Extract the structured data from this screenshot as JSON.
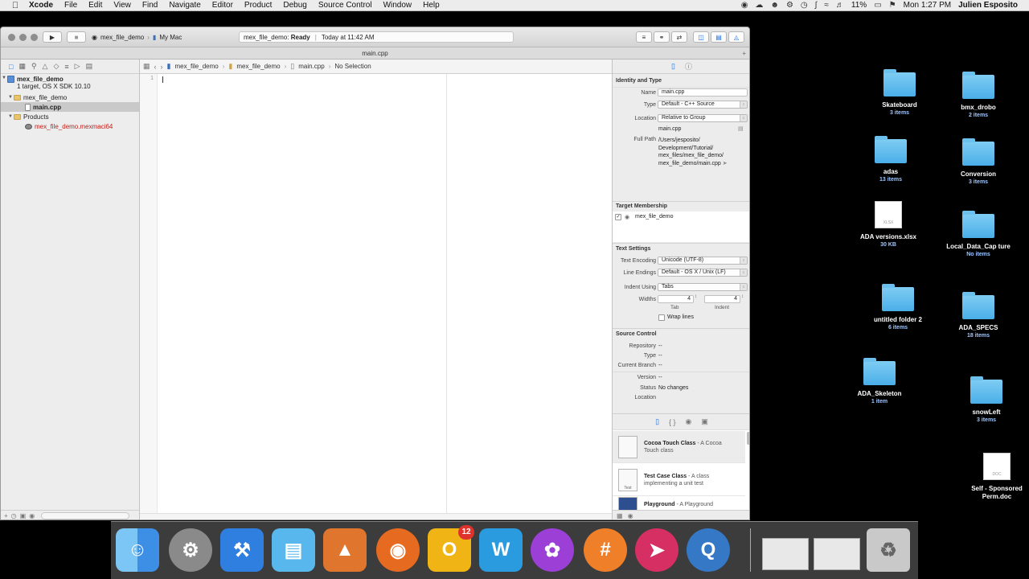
{
  "menubar": {
    "app": "Xcode",
    "menus": [
      "File",
      "Edit",
      "View",
      "Find",
      "Navigate",
      "Editor",
      "Product",
      "Debug",
      "Source Control",
      "Window",
      "Help"
    ],
    "battery": "11%",
    "clock": "Mon 1:27 PM",
    "user": "Julien Esposito"
  },
  "toolbar": {
    "scheme": "mex_file_demo",
    "destination": "My Mac",
    "activity_project": "mex_file_demo:",
    "activity_status": "Ready",
    "activity_time": "Today at 11:42 AM"
  },
  "tab": {
    "title": "main.cpp"
  },
  "navigator": {
    "project_name": "mex_file_demo",
    "project_sub": "1 target, OS X SDK 10.10",
    "group": "mex_file_demo",
    "file": "main.cpp",
    "products_group": "Products",
    "product": "mex_file_demo.mexmaci64"
  },
  "jumpbar": {
    "crumbs": [
      "mex_file_demo",
      "mex_file_demo",
      "main.cpp",
      "No Selection"
    ]
  },
  "editor": {
    "line_number": "1"
  },
  "inspector": {
    "identity": {
      "heading": "Identity and Type",
      "name_label": "Name",
      "name_value": "main.cpp",
      "type_label": "Type",
      "type_value": "Default - C++ Source",
      "location_label": "Location",
      "location_value": "Relative to Group",
      "location_file": "main.cpp",
      "fullpath_label": "Full Path",
      "fullpath_lines": [
        "/Users/jesposito/",
        "Development/Tutorial/",
        "mex_files/mex_file_demo/",
        "mex_file_demo/main.cpp"
      ]
    },
    "target": {
      "heading": "Target Membership",
      "item": "mex_file_demo"
    },
    "text": {
      "heading": "Text Settings",
      "encoding_label": "Text Encoding",
      "encoding_value": "Unicode (UTF-8)",
      "endings_label": "Line Endings",
      "endings_value": "Default - OS X / Unix (LF)",
      "indent_label": "Indent Using",
      "indent_value": "Tabs",
      "widths_label": "Widths",
      "tab_value": "4",
      "indent_width_value": "4",
      "tab_caption": "Tab",
      "indent_caption": "Indent",
      "wrap_label": "Wrap lines"
    },
    "source_control": {
      "heading": "Source Control",
      "repo_label": "Repository",
      "repo_value": "--",
      "type_label": "Type",
      "type_value": "--",
      "branch_label": "Current Branch",
      "branch_value": "--",
      "version_label": "Version",
      "version_value": "--",
      "status_label": "Status",
      "status_value": "No changes",
      "location_label": "Location"
    },
    "library": [
      {
        "title": "Cocoa Touch Class",
        "desc1": " - A Cocoa",
        "desc2": "Touch class"
      },
      {
        "title": "Test Case Class",
        "desc1": " - A class",
        "desc2": "implementing a unit test",
        "icon_text": "Test"
      },
      {
        "title": "Playground",
        "desc1": " - A Playground",
        "desc2": ""
      }
    ]
  },
  "desktop": [
    {
      "name": "Skateboard",
      "sub": "3 items",
      "kind": "folder"
    },
    {
      "name": "bmx_drobo",
      "sub": "2 items",
      "kind": "folder"
    },
    {
      "name": "adas",
      "sub": "13 items",
      "kind": "folder"
    },
    {
      "name": "Conversion",
      "sub": "3 items",
      "kind": "folder"
    },
    {
      "name": "ADA versions.xlsx",
      "sub": "30 KB",
      "kind": "file",
      "icon_text": "XLSX"
    },
    {
      "name": "Local_Data_Cap ture",
      "sub": "No items",
      "kind": "folder"
    },
    {
      "name": "untitled folder 2",
      "sub": "6 items",
      "kind": "folder"
    },
    {
      "name": "ADA_SPECS",
      "sub": "18 items",
      "kind": "folder"
    },
    {
      "name": "ADA_Skeleton",
      "sub": "1 item",
      "kind": "folder"
    },
    {
      "name": "snowLeft",
      "sub": "3 items",
      "kind": "folder"
    },
    {
      "name": "Self - Sponsored Perm.doc",
      "sub": "",
      "kind": "file",
      "icon_text": "DOC"
    }
  ],
  "dock": {
    "outlook_badge": "12",
    "colors": {
      "finder": "#3d8fe6",
      "prefs": "#8a8a8a",
      "xcode": "#2f7fe0",
      "folder": "#58b8ee",
      "matlab": "#e0752d",
      "firefox": "#e66a1f",
      "outlook": "#f0b515",
      "word": "#2b9be0",
      "flower": "#9b3fd6",
      "slack": "#f07f2a",
      "airmail": "#d62f63",
      "quicktime": "#3478c6"
    }
  }
}
